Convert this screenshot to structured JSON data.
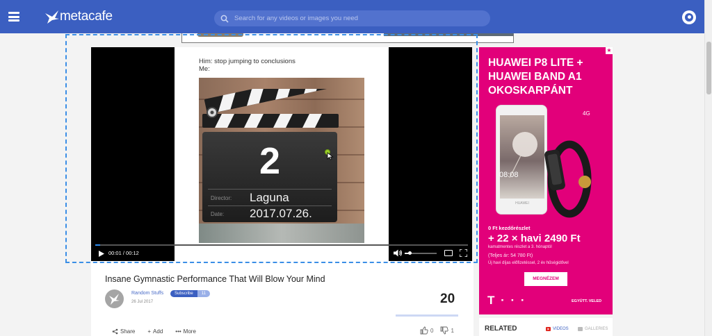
{
  "header": {
    "logo_text": "metacafe",
    "search_placeholder": "Search for any videos or images you need"
  },
  "player": {
    "meme_line1": "Him: stop jumping to conclusions",
    "meme_line2": "Me:",
    "clapboard_number": "2",
    "director_label": "Director:",
    "director_value": "Laguna",
    "date_label": "Date:",
    "date_value": "2017.07.26.",
    "time_display": "00:01 / 00:12",
    "progress": 0.013,
    "volume": 0.15
  },
  "video": {
    "title": "Insane Gymnastic Performance That Will Blow Your Mind",
    "channel": "Random Stuffs",
    "date": "26 Jul 2017",
    "subscribe_label": "Subscribe",
    "subscriber_count": "11",
    "views": "20",
    "share_label": "Share",
    "add_label": "Add",
    "more_label": "More",
    "likes": "0",
    "dislikes": "1"
  },
  "ad": {
    "headline_1": "HUAWEI P8 LITE +",
    "headline_2": "HUAWEI BAND A1",
    "headline_3": "OKOSKARPÁNT",
    "badge_4g": "4G",
    "phone_time": "08:08",
    "phone_label": "HUAWEI",
    "down_payment": "0 Ft kezdőrészlet",
    "price": "+ 22 × havi 2490 Ft",
    "fine_1": "kamatmentes részlet a 3. hónaptól",
    "fine_2": "(Teljes ár: 54 780 Ft)",
    "fine_3": "Új havi díjas előfizetéssel, 2 év hűségidővel",
    "cta": "MEGNÉZEM",
    "brand": "T · · ·",
    "tagline": "EGYÜTT. VELED",
    "colors": {
      "magenta": "#e2007a"
    }
  },
  "related": {
    "title": "RELATED",
    "tab_videos": "VIDEOS",
    "tab_galleries": "GALLERIES"
  },
  "colors": {
    "header_blue": "#3b5fc1",
    "selection_dash": "#3a8ee6"
  }
}
